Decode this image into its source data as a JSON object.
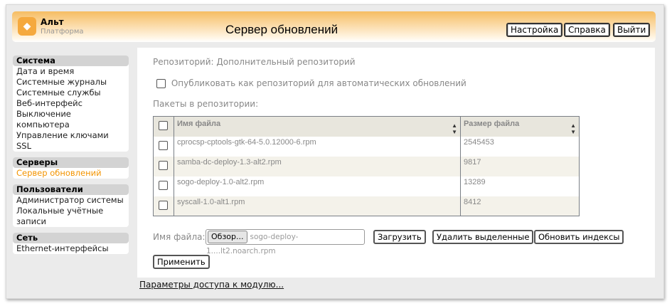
{
  "header": {
    "brand_name": "Альт",
    "brand_sub": "Платформа",
    "title": "Сервер обновлений",
    "buttons": [
      "Настройка",
      "Справка",
      "Выйти"
    ]
  },
  "sidebar": {
    "groups": [
      {
        "title": "Система",
        "items": [
          "Дата и время",
          "Системные журналы",
          "Системные службы",
          "Веб-интерфейс",
          "Выключение компьютера",
          "Управление ключами SSL"
        ]
      },
      {
        "title": "Серверы",
        "items": [
          "Сервер обновлений"
        ]
      },
      {
        "title": "Пользователи",
        "items": [
          "Администратор системы",
          "Локальные учётные записи"
        ]
      },
      {
        "title": "Сеть",
        "items": [
          "Ethernet-интерфейсы"
        ]
      }
    ],
    "active": "Сервер обновлений",
    "accent": "#f39400"
  },
  "main": {
    "repo_label": "Репозиторий: Дополнительный репозиторий",
    "publish_label": "Опубликовать как репозиторий для автоматических обновлений",
    "publish_checked": false,
    "packages_label": "Пакеты в репозитории:",
    "table": {
      "headers": [
        "Имя файла",
        "Размер файла"
      ],
      "rows": [
        {
          "name": "cprocsp-cptools-gtk-64-5.0.12000-6.rpm",
          "size": "2545453"
        },
        {
          "name": "samba-dc-deploy-1.3-alt2.rpm",
          "size": "9817"
        },
        {
          "name": "sogo-deploy-1.0-alt2.rpm",
          "size": "13289"
        },
        {
          "name": "syscall-1.0-alt1.rpm",
          "size": "8412"
        }
      ]
    },
    "file_label": "Имя файла:",
    "browse": "Обзор...",
    "file_value": "sogo-deploy-1....lt2.noarch.rpm",
    "upload": "Загрузить",
    "delete": "Удалить выделенные",
    "reindex": "Обновить индексы",
    "apply": "Применить"
  },
  "footer": {
    "link": "Параметры доступа к модулю..."
  }
}
